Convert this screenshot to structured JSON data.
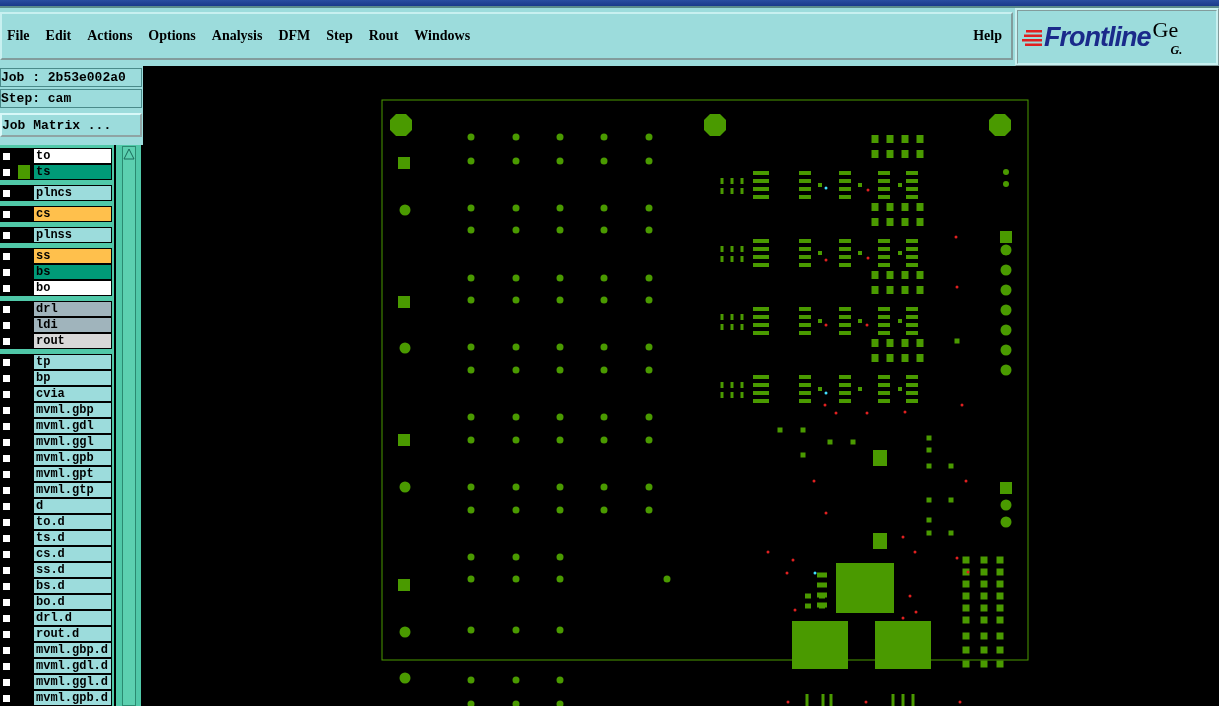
{
  "menu": [
    {
      "label": "File"
    },
    {
      "label": "Edit"
    },
    {
      "label": "Actions"
    },
    {
      "label": "Options"
    },
    {
      "label": "Analysis"
    },
    {
      "label": "DFM"
    },
    {
      "label": "Step"
    },
    {
      "label": "Rout"
    },
    {
      "label": "Windows"
    }
  ],
  "help": {
    "label": "Help"
  },
  "logo": {
    "brand": "Frontline",
    "title": "Ge",
    "subtitle": "G."
  },
  "job": {
    "job_line": "Job : 2b53e002a0",
    "step_line": "Step: cam",
    "matrix_button": "Job Matrix ..."
  },
  "layer_groups": [
    {
      "layers": [
        {
          "name": "to",
          "color": "#ffffff",
          "checked": false,
          "shown": false
        },
        {
          "name": "ts",
          "color": "#009a78",
          "checked": false,
          "shown": true
        }
      ]
    },
    {
      "layers": [
        {
          "name": "plncs",
          "color": "#9cdcdc",
          "checked": false,
          "shown": false
        }
      ]
    },
    {
      "layers": [
        {
          "name": "cs",
          "color": "#ffc04c",
          "checked": false,
          "shown": false
        }
      ]
    },
    {
      "layers": [
        {
          "name": "plnss",
          "color": "#9cdcdc",
          "checked": false,
          "shown": false
        }
      ]
    },
    {
      "layers": [
        {
          "name": "ss",
          "color": "#ffc04c",
          "checked": false,
          "shown": false
        },
        {
          "name": "bs",
          "color": "#009a78",
          "checked": false,
          "shown": false
        },
        {
          "name": "bo",
          "color": "#ffffff",
          "checked": false,
          "shown": false
        }
      ]
    },
    {
      "layers": [
        {
          "name": "drl",
          "color": "#a0b4bc",
          "checked": false,
          "shown": false
        },
        {
          "name": "ldi",
          "color": "#a0b4bc",
          "checked": false,
          "shown": false
        },
        {
          "name": "rout",
          "color": "#d8d8d8",
          "checked": false,
          "shown": false
        }
      ]
    },
    {
      "layers": [
        {
          "name": "tp",
          "color": "#9cdcdc",
          "checked": false,
          "shown": false
        },
        {
          "name": "bp",
          "color": "#9cdcdc",
          "checked": false,
          "shown": false
        },
        {
          "name": "cvia",
          "color": "#9cdcdc",
          "checked": false,
          "shown": false
        },
        {
          "name": "mvml.gbp",
          "color": "#9cdcdc",
          "checked": false,
          "shown": false
        },
        {
          "name": "mvml.gdl",
          "color": "#9cdcdc",
          "checked": false,
          "shown": false
        },
        {
          "name": "mvml.ggl",
          "color": "#9cdcdc",
          "checked": false,
          "shown": false
        },
        {
          "name": "mvml.gpb",
          "color": "#9cdcdc",
          "checked": false,
          "shown": false
        },
        {
          "name": "mvml.gpt",
          "color": "#9cdcdc",
          "checked": false,
          "shown": false
        },
        {
          "name": "mvml.gtp",
          "color": "#9cdcdc",
          "checked": false,
          "shown": false
        },
        {
          "name": "d",
          "color": "#9cdcdc",
          "checked": false,
          "shown": false
        },
        {
          "name": "to.d",
          "color": "#9cdcdc",
          "checked": false,
          "shown": false
        },
        {
          "name": "ts.d",
          "color": "#9cdcdc",
          "checked": false,
          "shown": false
        },
        {
          "name": "cs.d",
          "color": "#9cdcdc",
          "checked": false,
          "shown": false
        },
        {
          "name": "ss.d",
          "color": "#9cdcdc",
          "checked": false,
          "shown": false
        },
        {
          "name": "bs.d",
          "color": "#9cdcdc",
          "checked": false,
          "shown": false
        },
        {
          "name": "bo.d",
          "color": "#9cdcdc",
          "checked": false,
          "shown": false
        },
        {
          "name": "drl.d",
          "color": "#9cdcdc",
          "checked": false,
          "shown": false
        },
        {
          "name": "rout.d",
          "color": "#9cdcdc",
          "checked": false,
          "shown": false
        },
        {
          "name": "mvml.gbp.d",
          "color": "#9cdcdc",
          "checked": false,
          "shown": false
        },
        {
          "name": "mvml.gdl.d",
          "color": "#9cdcdc",
          "checked": false,
          "shown": false
        },
        {
          "name": "mvml.ggl.d",
          "color": "#9cdcdc",
          "checked": false,
          "shown": false
        },
        {
          "name": "mvml.gpb.d",
          "color": "#9cdcdc",
          "checked": false,
          "shown": false
        }
      ]
    }
  ]
}
